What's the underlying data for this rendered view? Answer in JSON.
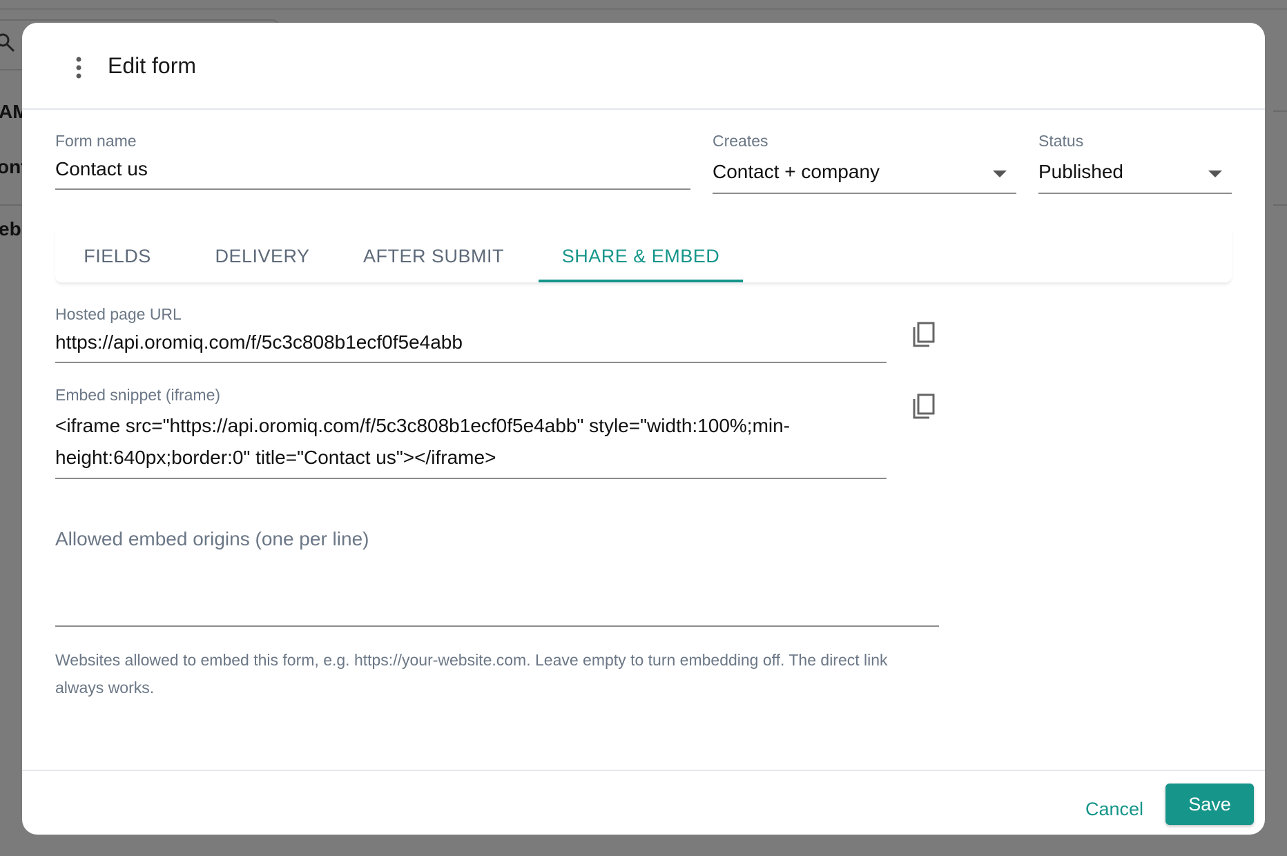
{
  "background": {
    "fragments": [
      "AM",
      "onta",
      "ebi"
    ]
  },
  "dialog": {
    "title": "Edit form",
    "menu_icon": "more-vert-icon"
  },
  "form": {
    "name_label": "Form name",
    "name_value": "Contact us",
    "creates_label": "Creates",
    "creates_value": "Contact + company",
    "status_label": "Status",
    "status_value": "Published"
  },
  "tabs": [
    {
      "label": "FIELDS",
      "active": false
    },
    {
      "label": "DELIVERY",
      "active": false
    },
    {
      "label": "AFTER SUBMIT",
      "active": false
    },
    {
      "label": "SHARE & EMBED",
      "active": true
    }
  ],
  "share": {
    "hosted_label": "Hosted page URL",
    "hosted_value": "https://api.oromiq.com/f/5c3c808b1ecf0f5e4abb",
    "embed_label": "Embed snippet (iframe)",
    "embed_line1": "<iframe src=\"https://api.oromiq.com/f/5c3c808b1ecf0f5e4abb\" style=\"width:100%;min-",
    "embed_line2": "height:640px;border:0\" title=\"Contact us\"></iframe>",
    "origins_label": "Allowed embed origins (one per line)",
    "origins_value": "",
    "helper_line1": "Websites allowed to embed this form, e.g. https://your-website.com. Leave empty to turn embedding off. The direct link",
    "helper_line2": "always works.",
    "copy_icon": "copy-icon"
  },
  "footer": {
    "cancel_label": "Cancel",
    "save_label": "Save"
  },
  "colors": {
    "accent": "#16958a",
    "overlay": "#7b7b7b",
    "label": "#6b7786"
  }
}
